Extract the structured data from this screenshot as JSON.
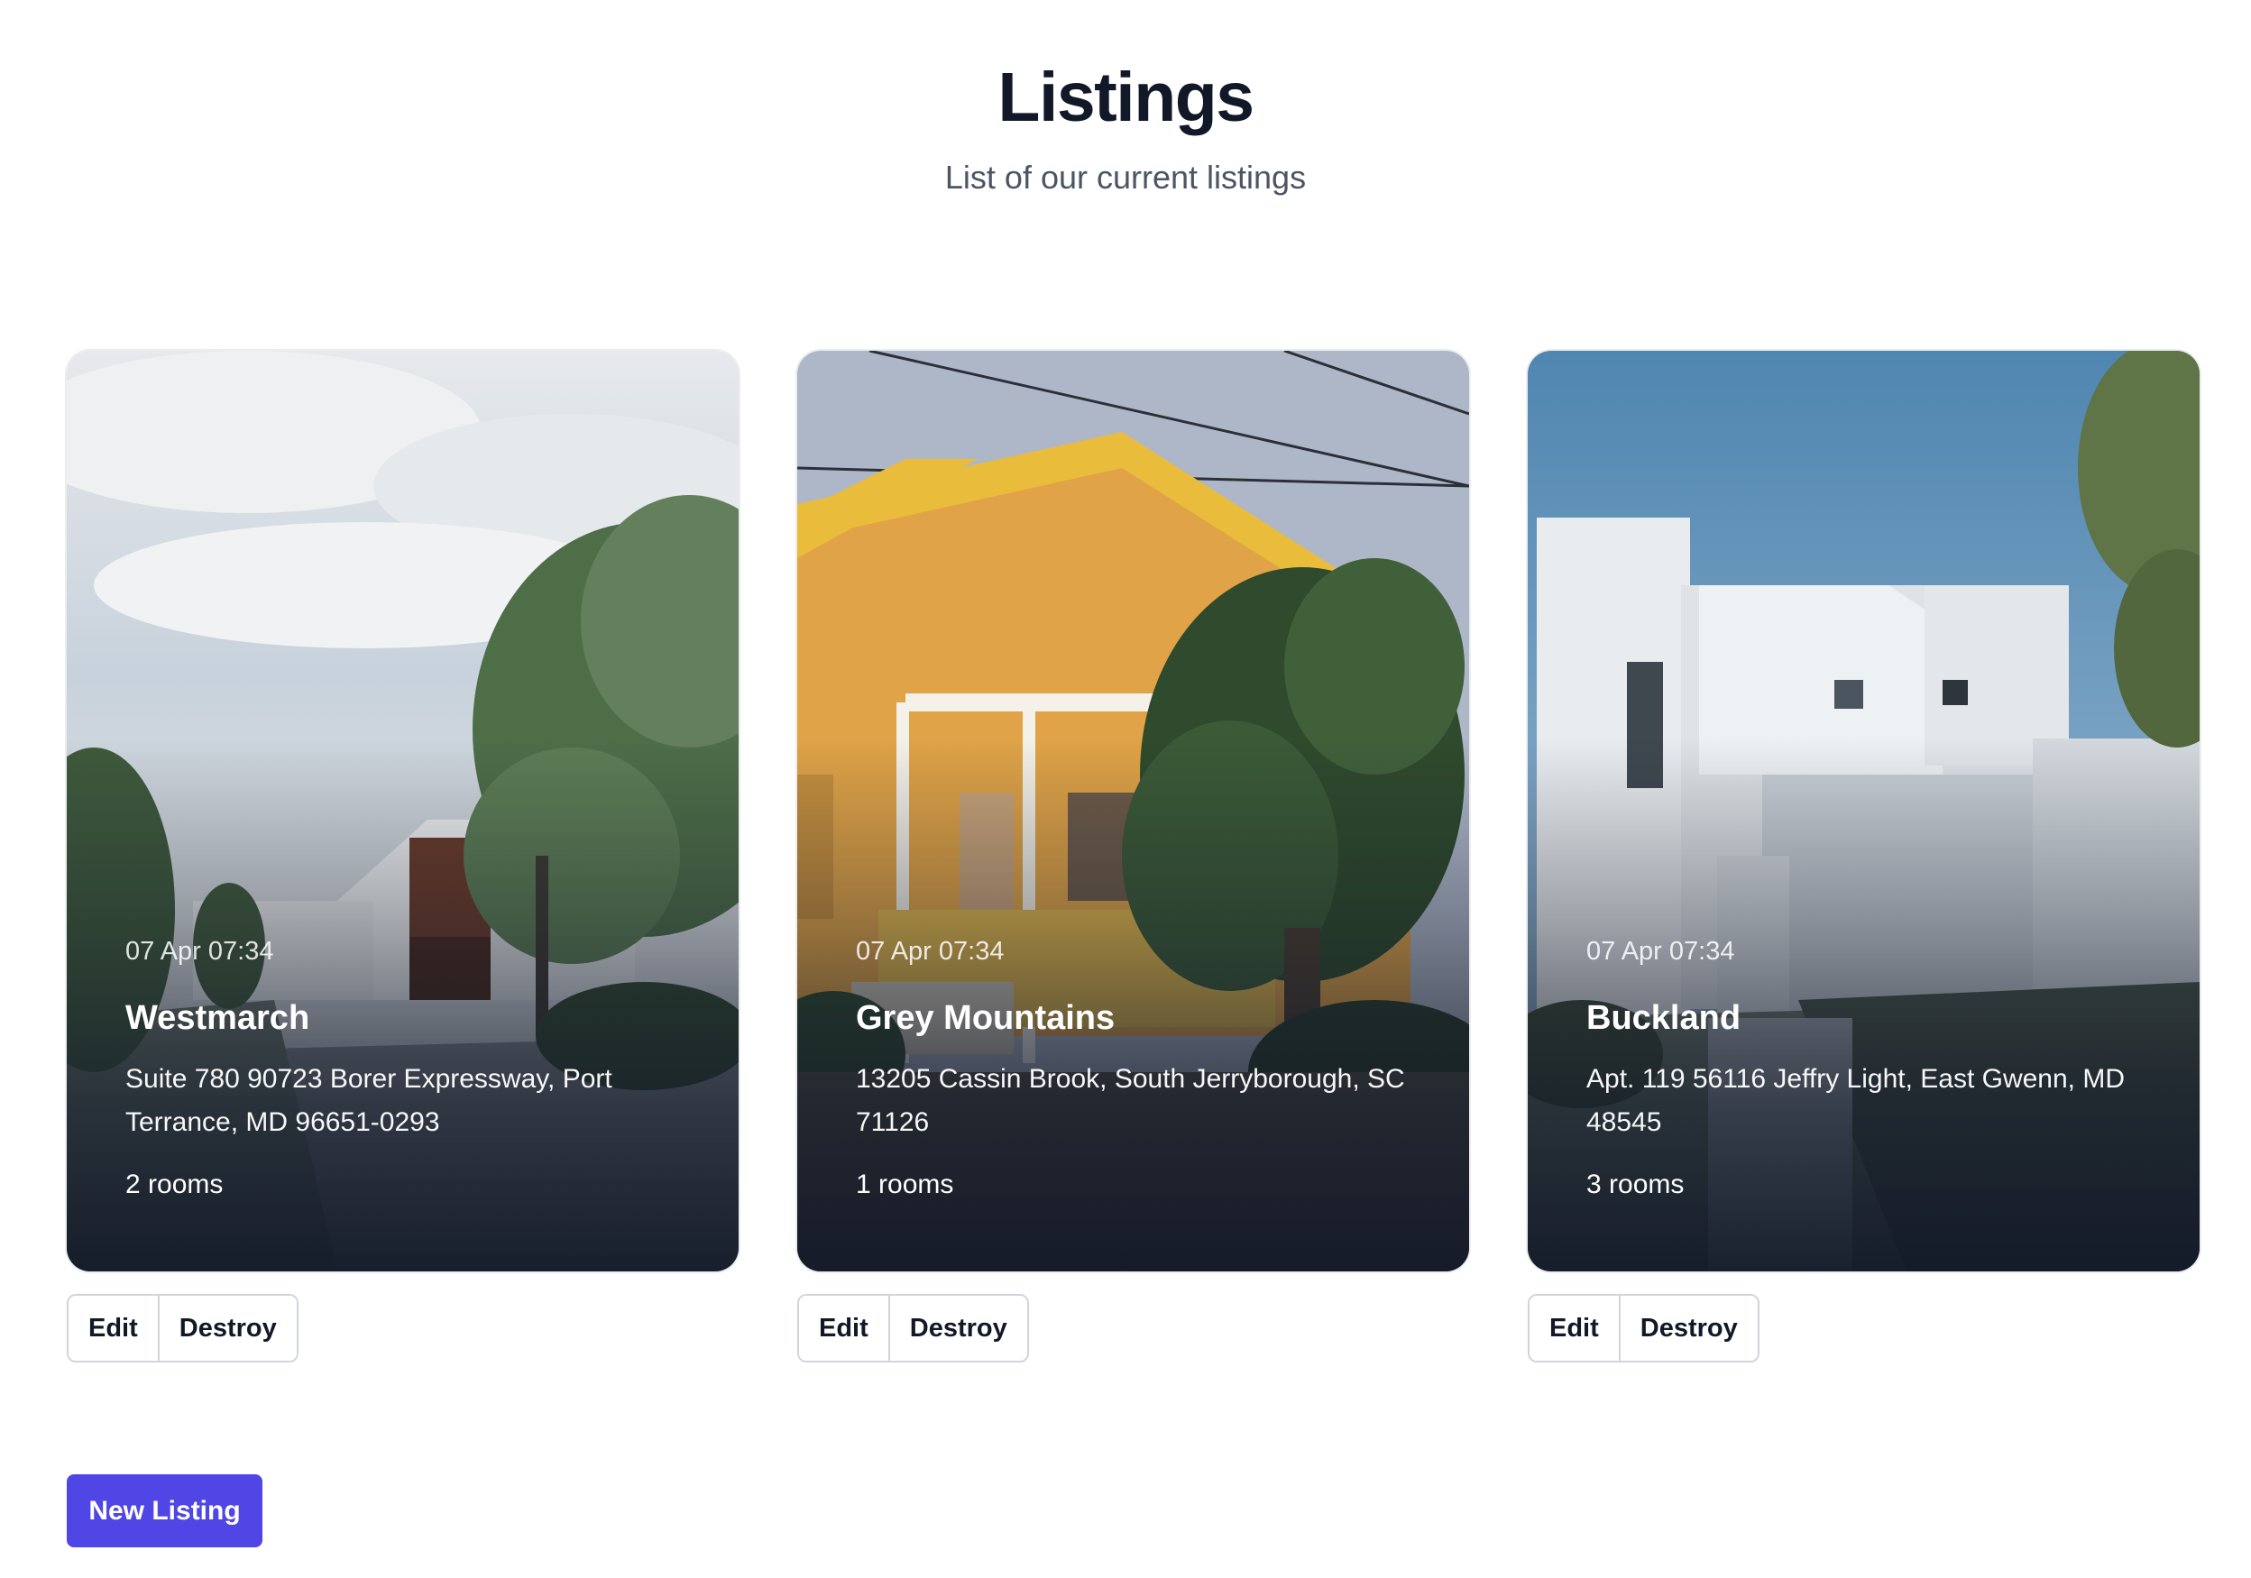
{
  "header": {
    "title": "Listings",
    "subtitle": "List of our current listings"
  },
  "listings": [
    {
      "date": "07 Apr 07:34",
      "name": "Westmarch",
      "address": "Suite 780 90723 Borer Expressway, Port Terrance, MD 96651-0293",
      "rooms": "2 rooms",
      "edit_label": "Edit",
      "destroy_label": "Destroy"
    },
    {
      "date": "07 Apr 07:34",
      "name": "Grey Mountains",
      "address": "13205 Cassin Brook, South Jerryborough, SC 71126",
      "rooms": "1 rooms",
      "edit_label": "Edit",
      "destroy_label": "Destroy"
    },
    {
      "date": "07 Apr 07:34",
      "name": "Buckland",
      "address": "Apt. 119 56116 Jeffry Light, East Gwenn, MD 48545",
      "rooms": "3 rooms",
      "edit_label": "Edit",
      "destroy_label": "Destroy"
    }
  ],
  "actions": {
    "new_listing_label": "New Listing"
  },
  "colors": {
    "primary": "#4f46e5",
    "heading": "#111827",
    "subtle_text": "#4b5563",
    "border": "#d1d5db"
  }
}
